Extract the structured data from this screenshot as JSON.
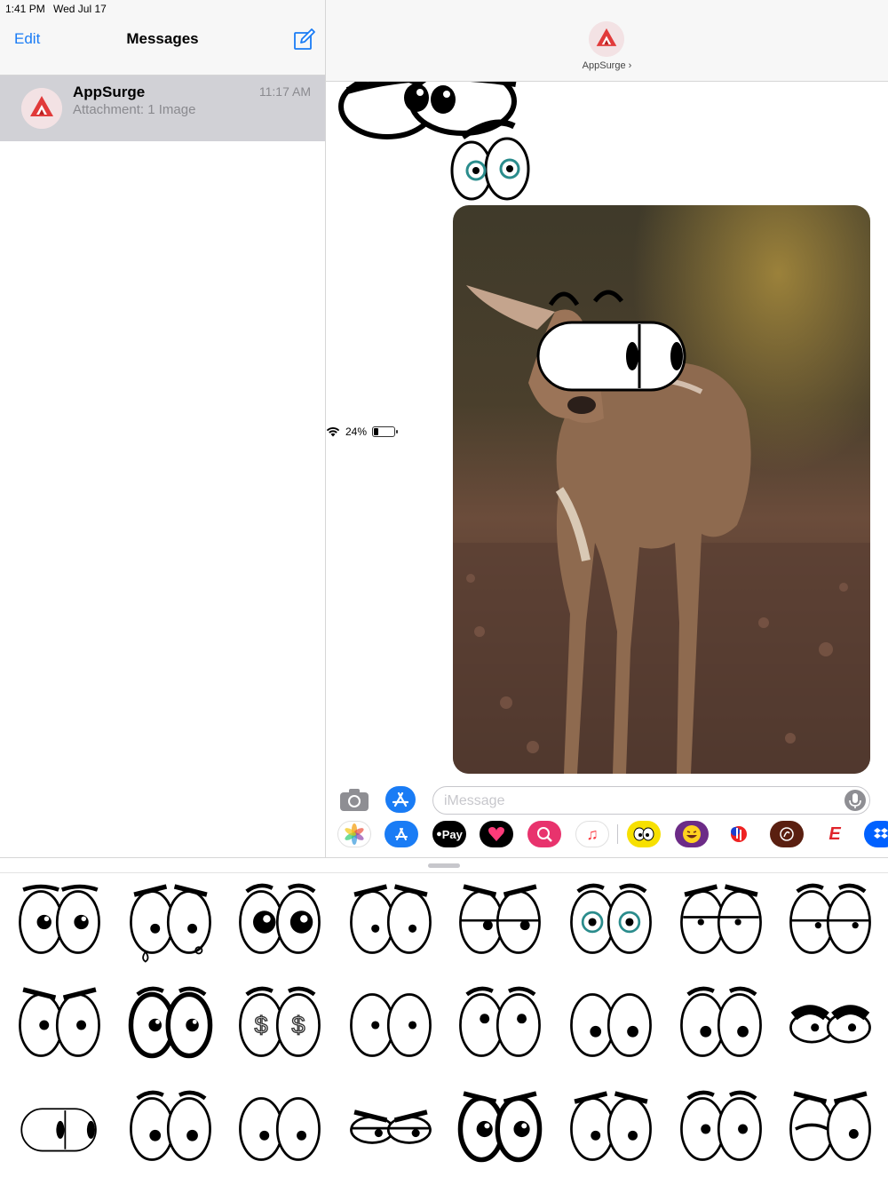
{
  "status": {
    "time": "1:41 PM",
    "date": "Wed Jul 17",
    "battery": "24%",
    "battery_level": 0.24
  },
  "sidebar": {
    "edit_label": "Edit",
    "title": "Messages",
    "conversations": [
      {
        "name": "AppSurge",
        "snippet": "Attachment: 1 Image",
        "time": "11:17 AM"
      }
    ]
  },
  "thread": {
    "contact_name": "AppSurge",
    "input_placeholder": "iMessage"
  },
  "app_tray": {
    "apple_pay_label": "Pay",
    "espn_label": "E",
    "icons": [
      "photos-icon",
      "app-store-icon",
      "apple-pay-icon",
      "digital-touch-icon",
      "web-search-icon",
      "music-icon",
      "sticker-eyes-app-icon",
      "emoji-app-icon",
      "splash-app-icon",
      "gif-app-icon",
      "espn-app-icon",
      "dropbox-icon"
    ]
  },
  "stickers": {
    "rows": 3,
    "columns": 8,
    "icons": [
      "eyes-sticker-icon"
    ]
  },
  "colors": {
    "accent": "#1a7cf5",
    "selection": "#d1d1d6",
    "brand": "#e13a3a"
  }
}
